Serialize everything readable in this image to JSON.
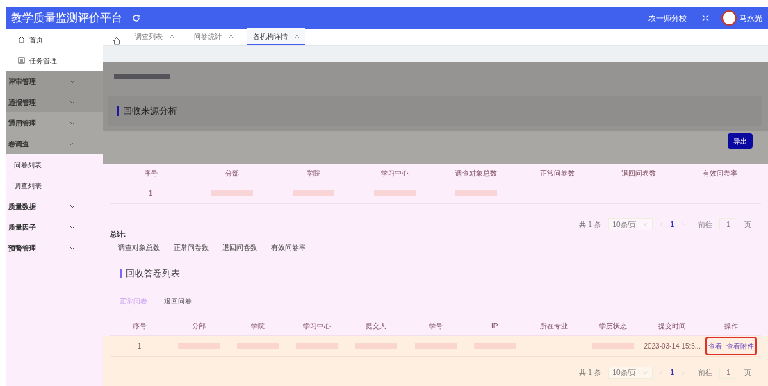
{
  "app": {
    "title": "教学质量监测评价平台",
    "org": "农一师分校",
    "user": "马永光"
  },
  "tabs": [
    {
      "label": "调查列表",
      "selected": false
    },
    {
      "label": "问卷统计",
      "selected": false
    },
    {
      "label": "各机构详情",
      "selected": true
    }
  ],
  "sidebar": {
    "items": [
      {
        "label": "首页",
        "kind": "home"
      },
      {
        "label": "任务管理",
        "kind": "task"
      },
      {
        "label": "评审管理",
        "kind": "group",
        "expanded": false
      },
      {
        "label": "通报管理",
        "kind": "group",
        "expanded": false
      },
      {
        "label": "通用管理",
        "kind": "group",
        "expanded": false
      },
      {
        "label": "卷调查",
        "kind": "group",
        "expanded": true,
        "children": [
          {
            "label": "问卷列表",
            "kind": "link"
          },
          {
            "label": "调查列表",
            "kind": "link"
          }
        ]
      },
      {
        "label": "质量数据",
        "kind": "group",
        "expanded": false
      },
      {
        "label": "质量因子",
        "kind": "group",
        "expanded": false
      },
      {
        "label": "预警管理",
        "kind": "group",
        "expanded": false
      }
    ]
  },
  "source_analysis": {
    "title": "回收来源分析",
    "export_button": "导出",
    "columns": [
      "序号",
      "分部",
      "学院",
      "学习中心",
      "调查对象总数",
      "正常问卷数",
      "退回问卷数",
      "有效问卷率"
    ],
    "rows": [
      [
        {
          "text": "1",
          "redacted": false
        },
        {
          "redacted": true
        },
        {
          "redacted": true
        },
        {
          "redacted": true
        },
        {
          "redacted": true
        },
        {
          "redacted": false
        },
        {
          "redacted": false
        },
        {
          "redacted": false
        }
      ]
    ],
    "pagination": {
      "total": "共 1 条",
      "page_size": "10条/页",
      "page": "1",
      "goto_label": "前往",
      "goto_value": "1",
      "goto_unit": "页"
    },
    "summary": {
      "label": "总计:",
      "items": [
        "调查对象总数",
        "正常问卷数",
        "退回问卷数",
        "有效问卷率"
      ]
    }
  },
  "answers": {
    "title": "回收答卷列表",
    "subtabs": [
      {
        "label": "正常问卷",
        "selected": true
      },
      {
        "label": "退回问卷",
        "selected": false
      }
    ],
    "columns": [
      "序号",
      "分部",
      "学院",
      "学习中心",
      "提交人",
      "学号",
      "IP",
      "所在专业",
      "学历状态",
      "提交时间",
      "操作"
    ],
    "rows": [
      {
        "cells": [
          {
            "text": "1",
            "redacted": false
          },
          {
            "redacted": true
          },
          {
            "redacted": true
          },
          {
            "redacted": true
          },
          {
            "redacted": true
          },
          {
            "redacted": true
          },
          {
            "redacted": true
          },
          {
            "redacted": false
          },
          {
            "redacted": true
          },
          {
            "text": "2023-03-14 15:5...",
            "redacted": false
          }
        ],
        "actions": [
          "查看",
          "查看附件"
        ],
        "actions_highlighted": true
      }
    ],
    "pagination": {
      "total": "共 1 条",
      "page_size": "10条/页",
      "page": "1",
      "goto_label": "前往",
      "goto_value": "1",
      "goto_unit": "页"
    }
  }
}
